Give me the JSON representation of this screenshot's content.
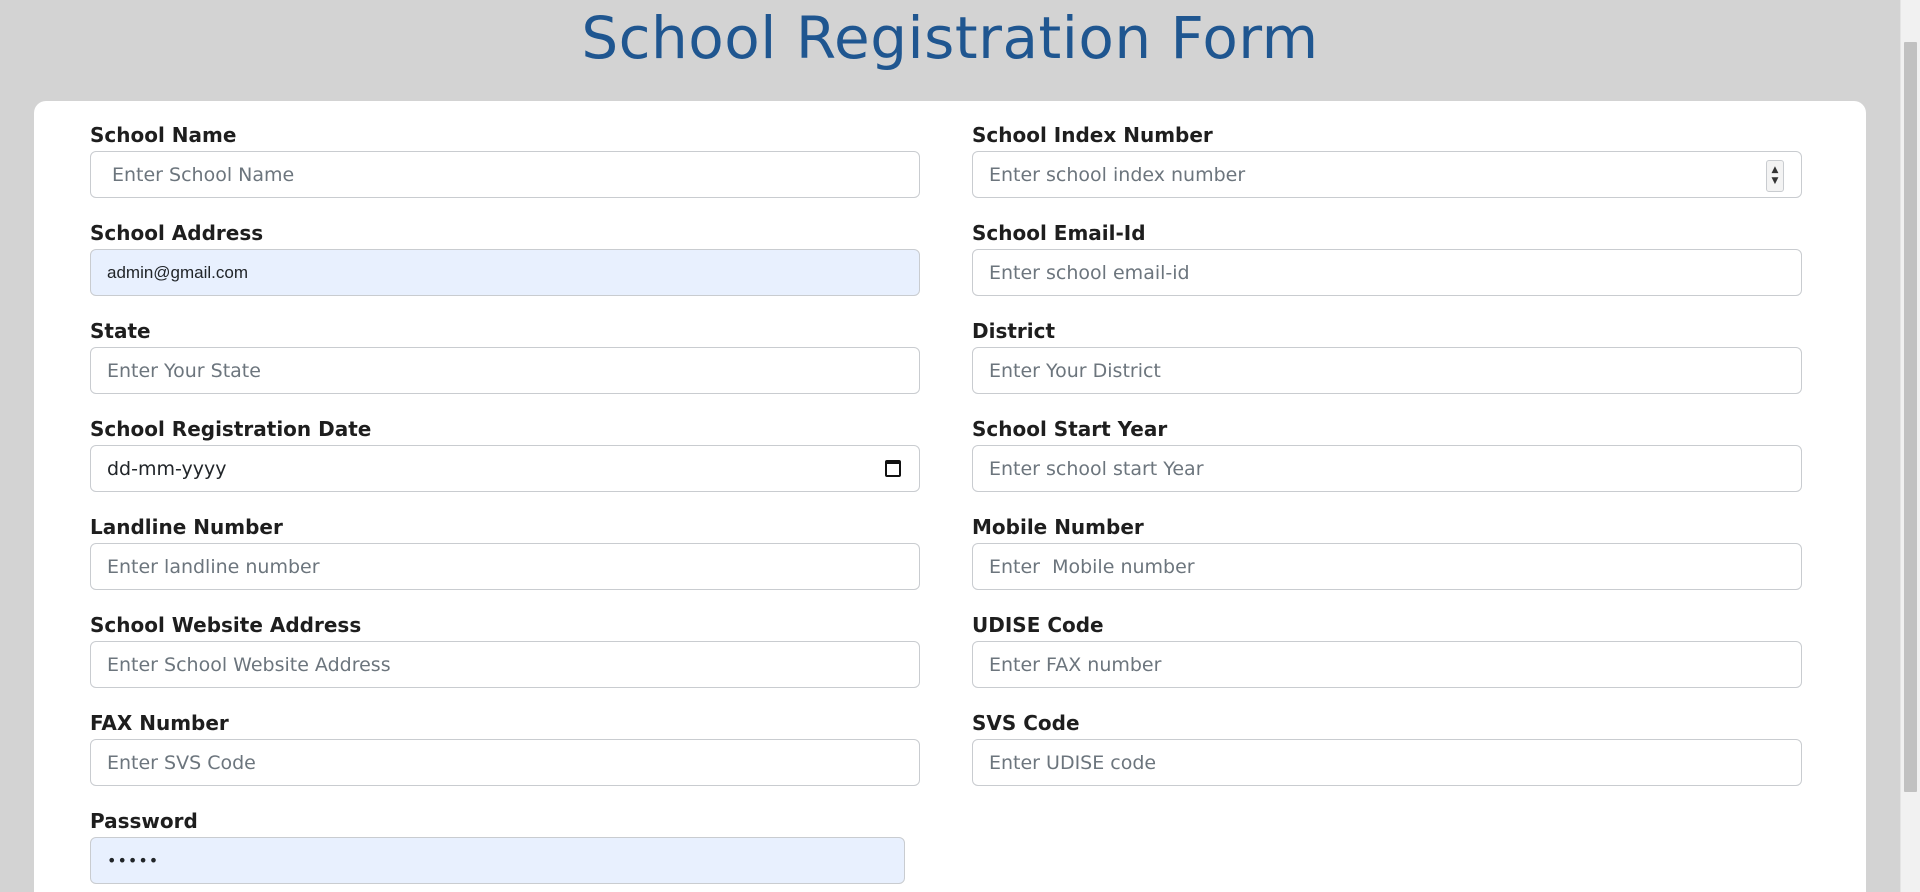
{
  "page": {
    "title": "School Registration Form"
  },
  "fields": {
    "school_name": {
      "label": "School Name",
      "placeholder": "Enter School Name",
      "value": ""
    },
    "school_index_number": {
      "label": "School Index Number",
      "placeholder": "Enter school index number",
      "value": ""
    },
    "school_address": {
      "label": "School Address",
      "placeholder": "",
      "value": "admin@gmail.com"
    },
    "school_email": {
      "label": "School Email-Id",
      "placeholder": "Enter school email-id",
      "value": ""
    },
    "state": {
      "label": "State",
      "placeholder": "Enter Your State",
      "value": ""
    },
    "district": {
      "label": "District",
      "placeholder": "Enter Your District",
      "value": ""
    },
    "registration_date": {
      "label": "School Registration Date",
      "display": "dd-mm-yyyy"
    },
    "start_year": {
      "label": "School Start Year",
      "placeholder": "Enter school start Year",
      "value": ""
    },
    "landline": {
      "label": "Landline Number",
      "placeholder": "Enter landline number",
      "value": ""
    },
    "mobile": {
      "label": "Mobile Number",
      "placeholder": "Enter  Mobile number",
      "value": ""
    },
    "website": {
      "label": "School Website Address",
      "placeholder": "Enter School Website Address",
      "value": ""
    },
    "udise": {
      "label": "UDISE Code",
      "placeholder": "Enter FAX number",
      "value": ""
    },
    "fax": {
      "label": "FAX Number",
      "placeholder": "Enter SVS Code",
      "value": ""
    },
    "svs": {
      "label": "SVS Code",
      "placeholder": "Enter UDISE code",
      "value": ""
    },
    "password": {
      "label": "Password",
      "value": "•••••"
    }
  },
  "icons": {
    "calendar": "calendar-icon",
    "spinner_up": "▲",
    "spinner_down": "▼"
  },
  "colors": {
    "title": "#1f5690",
    "autofill_background": "#e8f0fe"
  }
}
